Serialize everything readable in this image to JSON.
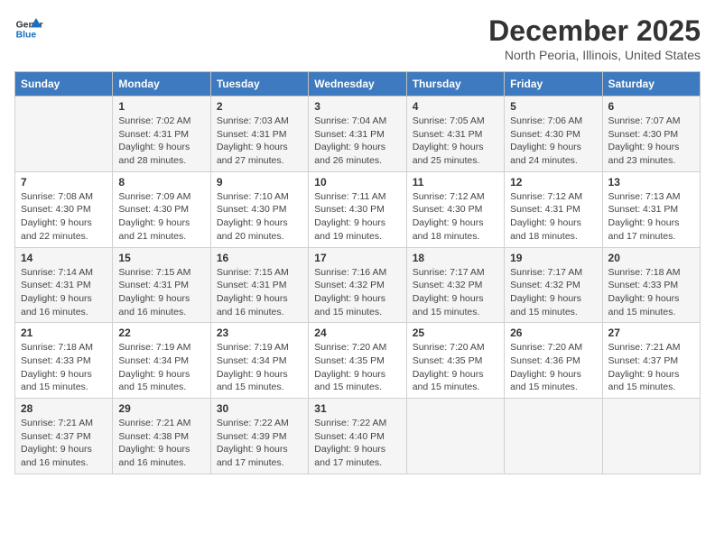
{
  "header": {
    "logo_general": "General",
    "logo_blue": "Blue",
    "month_title": "December 2025",
    "location": "North Peoria, Illinois, United States"
  },
  "days_of_week": [
    "Sunday",
    "Monday",
    "Tuesday",
    "Wednesday",
    "Thursday",
    "Friday",
    "Saturday"
  ],
  "weeks": [
    [
      {
        "day": "",
        "sunrise": "",
        "sunset": "",
        "daylight": ""
      },
      {
        "day": "1",
        "sunrise": "Sunrise: 7:02 AM",
        "sunset": "Sunset: 4:31 PM",
        "daylight": "Daylight: 9 hours and 28 minutes."
      },
      {
        "day": "2",
        "sunrise": "Sunrise: 7:03 AM",
        "sunset": "Sunset: 4:31 PM",
        "daylight": "Daylight: 9 hours and 27 minutes."
      },
      {
        "day": "3",
        "sunrise": "Sunrise: 7:04 AM",
        "sunset": "Sunset: 4:31 PM",
        "daylight": "Daylight: 9 hours and 26 minutes."
      },
      {
        "day": "4",
        "sunrise": "Sunrise: 7:05 AM",
        "sunset": "Sunset: 4:31 PM",
        "daylight": "Daylight: 9 hours and 25 minutes."
      },
      {
        "day": "5",
        "sunrise": "Sunrise: 7:06 AM",
        "sunset": "Sunset: 4:30 PM",
        "daylight": "Daylight: 9 hours and 24 minutes."
      },
      {
        "day": "6",
        "sunrise": "Sunrise: 7:07 AM",
        "sunset": "Sunset: 4:30 PM",
        "daylight": "Daylight: 9 hours and 23 minutes."
      }
    ],
    [
      {
        "day": "7",
        "sunrise": "Sunrise: 7:08 AM",
        "sunset": "Sunset: 4:30 PM",
        "daylight": "Daylight: 9 hours and 22 minutes."
      },
      {
        "day": "8",
        "sunrise": "Sunrise: 7:09 AM",
        "sunset": "Sunset: 4:30 PM",
        "daylight": "Daylight: 9 hours and 21 minutes."
      },
      {
        "day": "9",
        "sunrise": "Sunrise: 7:10 AM",
        "sunset": "Sunset: 4:30 PM",
        "daylight": "Daylight: 9 hours and 20 minutes."
      },
      {
        "day": "10",
        "sunrise": "Sunrise: 7:11 AM",
        "sunset": "Sunset: 4:30 PM",
        "daylight": "Daylight: 9 hours and 19 minutes."
      },
      {
        "day": "11",
        "sunrise": "Sunrise: 7:12 AM",
        "sunset": "Sunset: 4:30 PM",
        "daylight": "Daylight: 9 hours and 18 minutes."
      },
      {
        "day": "12",
        "sunrise": "Sunrise: 7:12 AM",
        "sunset": "Sunset: 4:31 PM",
        "daylight": "Daylight: 9 hours and 18 minutes."
      },
      {
        "day": "13",
        "sunrise": "Sunrise: 7:13 AM",
        "sunset": "Sunset: 4:31 PM",
        "daylight": "Daylight: 9 hours and 17 minutes."
      }
    ],
    [
      {
        "day": "14",
        "sunrise": "Sunrise: 7:14 AM",
        "sunset": "Sunset: 4:31 PM",
        "daylight": "Daylight: 9 hours and 16 minutes."
      },
      {
        "day": "15",
        "sunrise": "Sunrise: 7:15 AM",
        "sunset": "Sunset: 4:31 PM",
        "daylight": "Daylight: 9 hours and 16 minutes."
      },
      {
        "day": "16",
        "sunrise": "Sunrise: 7:15 AM",
        "sunset": "Sunset: 4:31 PM",
        "daylight": "Daylight: 9 hours and 16 minutes."
      },
      {
        "day": "17",
        "sunrise": "Sunrise: 7:16 AM",
        "sunset": "Sunset: 4:32 PM",
        "daylight": "Daylight: 9 hours and 15 minutes."
      },
      {
        "day": "18",
        "sunrise": "Sunrise: 7:17 AM",
        "sunset": "Sunset: 4:32 PM",
        "daylight": "Daylight: 9 hours and 15 minutes."
      },
      {
        "day": "19",
        "sunrise": "Sunrise: 7:17 AM",
        "sunset": "Sunset: 4:32 PM",
        "daylight": "Daylight: 9 hours and 15 minutes."
      },
      {
        "day": "20",
        "sunrise": "Sunrise: 7:18 AM",
        "sunset": "Sunset: 4:33 PM",
        "daylight": "Daylight: 9 hours and 15 minutes."
      }
    ],
    [
      {
        "day": "21",
        "sunrise": "Sunrise: 7:18 AM",
        "sunset": "Sunset: 4:33 PM",
        "daylight": "Daylight: 9 hours and 15 minutes."
      },
      {
        "day": "22",
        "sunrise": "Sunrise: 7:19 AM",
        "sunset": "Sunset: 4:34 PM",
        "daylight": "Daylight: 9 hours and 15 minutes."
      },
      {
        "day": "23",
        "sunrise": "Sunrise: 7:19 AM",
        "sunset": "Sunset: 4:34 PM",
        "daylight": "Daylight: 9 hours and 15 minutes."
      },
      {
        "day": "24",
        "sunrise": "Sunrise: 7:20 AM",
        "sunset": "Sunset: 4:35 PM",
        "daylight": "Daylight: 9 hours and 15 minutes."
      },
      {
        "day": "25",
        "sunrise": "Sunrise: 7:20 AM",
        "sunset": "Sunset: 4:35 PM",
        "daylight": "Daylight: 9 hours and 15 minutes."
      },
      {
        "day": "26",
        "sunrise": "Sunrise: 7:20 AM",
        "sunset": "Sunset: 4:36 PM",
        "daylight": "Daylight: 9 hours and 15 minutes."
      },
      {
        "day": "27",
        "sunrise": "Sunrise: 7:21 AM",
        "sunset": "Sunset: 4:37 PM",
        "daylight": "Daylight: 9 hours and 15 minutes."
      }
    ],
    [
      {
        "day": "28",
        "sunrise": "Sunrise: 7:21 AM",
        "sunset": "Sunset: 4:37 PM",
        "daylight": "Daylight: 9 hours and 16 minutes."
      },
      {
        "day": "29",
        "sunrise": "Sunrise: 7:21 AM",
        "sunset": "Sunset: 4:38 PM",
        "daylight": "Daylight: 9 hours and 16 minutes."
      },
      {
        "day": "30",
        "sunrise": "Sunrise: 7:22 AM",
        "sunset": "Sunset: 4:39 PM",
        "daylight": "Daylight: 9 hours and 17 minutes."
      },
      {
        "day": "31",
        "sunrise": "Sunrise: 7:22 AM",
        "sunset": "Sunset: 4:40 PM",
        "daylight": "Daylight: 9 hours and 17 minutes."
      },
      {
        "day": "",
        "sunrise": "",
        "sunset": "",
        "daylight": ""
      },
      {
        "day": "",
        "sunrise": "",
        "sunset": "",
        "daylight": ""
      },
      {
        "day": "",
        "sunrise": "",
        "sunset": "",
        "daylight": ""
      }
    ]
  ]
}
